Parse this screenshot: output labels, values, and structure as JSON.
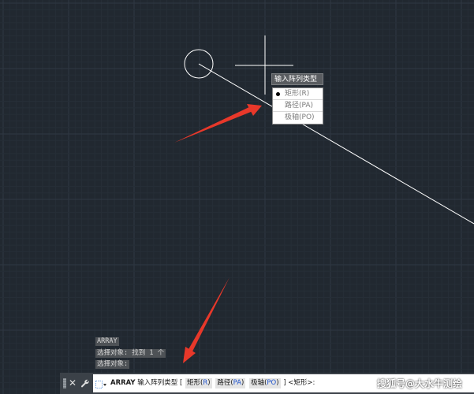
{
  "context_menu": {
    "title": "输入阵列类型",
    "items": [
      {
        "label": "矩形(R)",
        "selected": true
      },
      {
        "label": "路径(PA)",
        "selected": false
      },
      {
        "label": "极轴(PO)",
        "selected": false
      }
    ]
  },
  "history": [
    "ARRAY",
    "选择对象: 找到 1 个",
    "选择对象:"
  ],
  "command_line": {
    "command": "ARRAY",
    "prompt": "输入阵列类型",
    "open_bracket": "[",
    "options": [
      {
        "name": "矩形(",
        "key": "R",
        "close": ")"
      },
      {
        "name": "路径(",
        "key": "PA",
        "close": ")"
      },
      {
        "name": "极轴(",
        "key": "PO",
        "close": ")"
      }
    ],
    "close_bracket": "]",
    "default": "<矩形>:"
  },
  "toolbar": {
    "close_icon": "✕",
    "customize_icon": "🔧"
  },
  "watermark": "搜狐号@大水牛测绘",
  "colors": {
    "background": "#212830",
    "grid_major": "#2f3843",
    "grid_minor": "#262e37",
    "arrow": "#e8382a",
    "geometry": "#ffffff"
  }
}
